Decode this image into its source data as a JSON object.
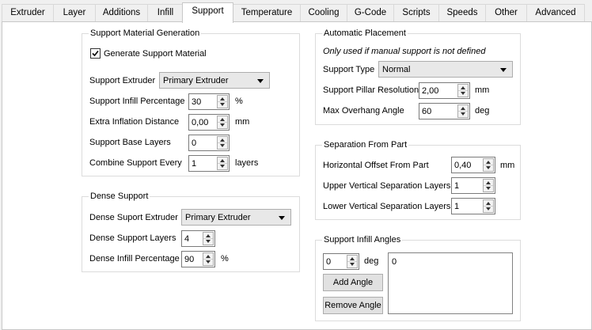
{
  "tabs": [
    {
      "label": "Extruder"
    },
    {
      "label": "Layer"
    },
    {
      "label": "Additions"
    },
    {
      "label": "Infill"
    },
    {
      "label": "Support"
    },
    {
      "label": "Temperature"
    },
    {
      "label": "Cooling"
    },
    {
      "label": "G-Code"
    },
    {
      "label": "Scripts"
    },
    {
      "label": "Speeds"
    },
    {
      "label": "Other"
    },
    {
      "label": "Advanced"
    }
  ],
  "active_tab": "Support",
  "support_generation": {
    "title": "Support Material Generation",
    "generate_label": "Generate Support Material",
    "generate_checked": true,
    "extruder_label": "Support Extruder",
    "extruder_value": "Primary Extruder",
    "infill_pct_label": "Support Infill Percentage",
    "infill_pct_value": "30",
    "infill_pct_unit": "%",
    "inflation_label": "Extra Inflation Distance",
    "inflation_value": "0,00",
    "inflation_unit": "mm",
    "base_layers_label": "Support Base Layers",
    "base_layers_value": "0",
    "combine_label": "Combine Support Every",
    "combine_value": "1",
    "combine_unit": "layers"
  },
  "dense_support": {
    "title": "Dense Support",
    "extruder_label": "Dense Suport Extruder",
    "extruder_value": "Primary Extruder",
    "layers_label": "Dense Support Layers",
    "layers_value": "4",
    "infill_label": "Dense Infill Percentage",
    "infill_value": "90",
    "infill_unit": "%"
  },
  "automatic_placement": {
    "title": "Automatic Placement",
    "note": "Only used if manual support is not defined",
    "type_label": "Support Type",
    "type_value": "Normal",
    "pillar_label": "Support Pillar Resolution",
    "pillar_value": "2,00",
    "pillar_unit": "mm",
    "overhang_label": "Max Overhang Angle",
    "overhang_value": "60",
    "overhang_unit": "deg"
  },
  "separation": {
    "title": "Separation From Part",
    "horizontal_label": "Horizontal Offset From Part",
    "horizontal_value": "0,40",
    "horizontal_unit": "mm",
    "upper_label": "Upper Vertical Separation Layers",
    "upper_value": "1",
    "lower_label": "Lower Vertical Separation Layers",
    "lower_value": "1"
  },
  "infill_angles": {
    "title": "Support Infill Angles",
    "angle_value": "0",
    "angle_unit": "deg",
    "add_label": "Add Angle",
    "remove_label": "Remove Angle",
    "list_items": [
      "0"
    ]
  }
}
